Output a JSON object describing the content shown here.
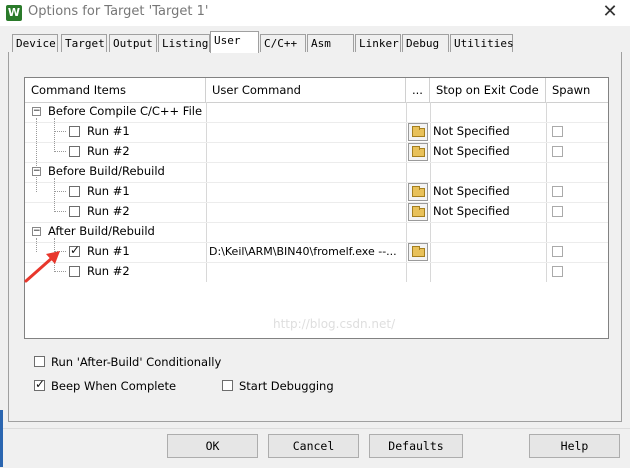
{
  "window": {
    "title": "Options for Target 'Target 1'",
    "close_glyph": "✕",
    "app_icon_glyph": "W"
  },
  "tabs": [
    {
      "label": "Device"
    },
    {
      "label": "Target"
    },
    {
      "label": "Output"
    },
    {
      "label": "Listing"
    },
    {
      "label": "User",
      "active": true
    },
    {
      "label": "C/C++"
    },
    {
      "label": "Asm"
    },
    {
      "label": "Linker"
    },
    {
      "label": "Debug"
    },
    {
      "label": "Utilities"
    }
  ],
  "table": {
    "headers": {
      "command_items": "Command Items",
      "user_command": "User Command",
      "browse": "...",
      "stop_on_exit": "Stop on Exit Code",
      "spawn": "Spawn"
    },
    "groups": [
      {
        "label": "Before Compile C/C++ File",
        "expander": "−",
        "rows": [
          {
            "label": "Run #1",
            "checked": false,
            "command": "",
            "stop": "Not Specified",
            "spawn": false
          },
          {
            "label": "Run #2",
            "checked": false,
            "command": "",
            "stop": "Not Specified",
            "spawn": false
          }
        ]
      },
      {
        "label": "Before Build/Rebuild",
        "expander": "−",
        "rows": [
          {
            "label": "Run #1",
            "checked": false,
            "command": "",
            "stop": "Not Specified",
            "spawn": false
          },
          {
            "label": "Run #2",
            "checked": false,
            "command": "",
            "stop": "Not Specified",
            "spawn": false
          }
        ]
      },
      {
        "label": "After Build/Rebuild",
        "expander": "−",
        "rows": [
          {
            "label": "Run #1",
            "checked": true,
            "command": "D:\\Keil\\ARM\\BIN40\\fromelf.exe --...",
            "stop": "",
            "spawn": false
          },
          {
            "label": "Run #2",
            "checked": false,
            "command": "",
            "stop": "",
            "spawn": false
          }
        ]
      }
    ]
  },
  "watermark": "http://blog.csdn.net/",
  "options": {
    "run_after_build": {
      "label": "Run 'After-Build' Conditionally",
      "checked": false
    },
    "beep": {
      "label": "Beep When Complete",
      "checked": true
    },
    "start_debugging": {
      "label": "Start Debugging",
      "checked": false
    }
  },
  "buttons": {
    "ok": "OK",
    "cancel": "Cancel",
    "defaults": "Defaults",
    "help": "Help"
  },
  "colors": {
    "arrow": "#e8372c",
    "accent": "#2b66b0"
  }
}
